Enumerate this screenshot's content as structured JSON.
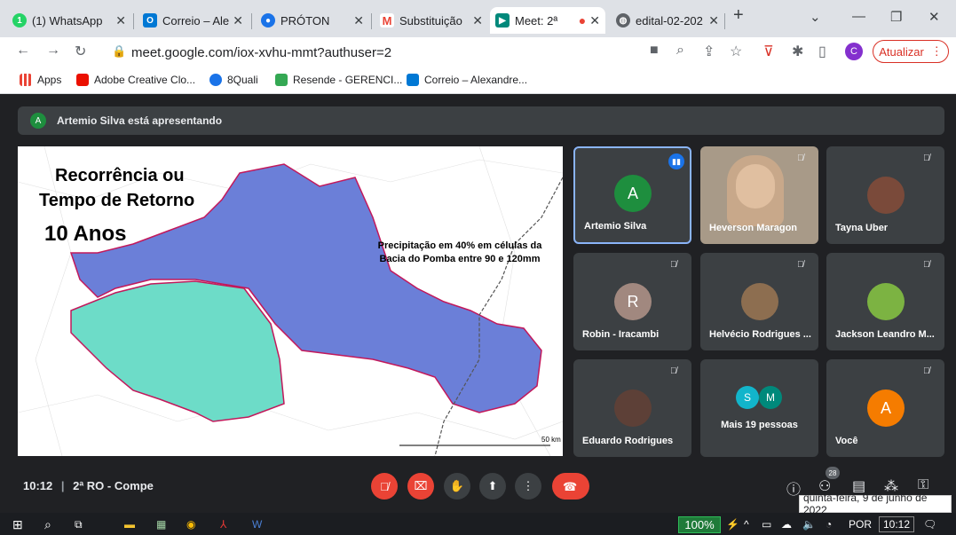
{
  "tabs": [
    {
      "label": "(1) WhatsApp",
      "icon": "whatsapp-icon",
      "color": "#25d366",
      "badge": "1"
    },
    {
      "label": "Correio – Alex",
      "icon": "outlook-icon",
      "color": "#0078d4"
    },
    {
      "label": "PRÓTON",
      "icon": "proton-icon",
      "color": "#1a73e8"
    },
    {
      "label": "Substituição",
      "icon": "gmail-icon",
      "color": "#ea4335"
    },
    {
      "label": "Meet: 2ª",
      "icon": "meet-icon",
      "color": "#00897b"
    },
    {
      "label": "edital-02-202",
      "icon": "globe-icon",
      "color": "#5f6368"
    }
  ],
  "address": {
    "url": "meet.google.com/iox-xvhu-mmt?authuser=2"
  },
  "browser": {
    "update_label": "Atualizar",
    "profile": "C"
  },
  "bookmarks": [
    {
      "label": "Apps",
      "color": "#ea4335"
    },
    {
      "label": "Adobe Creative Clo...",
      "color": "#eb1000"
    },
    {
      "label": "8Quali",
      "color": "#1a73e8"
    },
    {
      "label": "Resende - GERENCI...",
      "color": "#34a853"
    },
    {
      "label": "Correio – Alexandre...",
      "color": "#0078d4"
    }
  ],
  "banner": {
    "avatar": "A",
    "text": "Artemio Silva está apresentando"
  },
  "slide": {
    "title_line1": "Recorrência ou",
    "title_line2": "Tempo de Retorno",
    "title_line3": "10 Anos",
    "caption_line1": "Precipitação em 40%  em células da",
    "caption_line2": "Bacia do Pomba entre 90 e 120mm",
    "scale_label": "50 km",
    "colors": {
      "blue_region": "#6b7fd8",
      "teal_region": "#6ddcc8",
      "border": "#c2185b"
    }
  },
  "participants": [
    {
      "name": "Artemio Silva",
      "avatar": "A",
      "avatar_color": "#1e8e3e",
      "speaking": true
    },
    {
      "name": "Heverson Maragon",
      "avatar": "video"
    },
    {
      "name": "Tayna Uber",
      "avatar": "photo"
    },
    {
      "name": "Robin - Iracambi",
      "avatar": "R",
      "avatar_color": "#a1887f"
    },
    {
      "name": "Helvécio Rodrigues ...",
      "avatar": "photo"
    },
    {
      "name": "Jackson Leandro M...",
      "avatar": "photo"
    },
    {
      "name": "Eduardo Rodrigues",
      "avatar": "photo"
    },
    {
      "name": "Mais 19 pessoas",
      "avatar": "S M"
    },
    {
      "name": "Você",
      "avatar": "A",
      "avatar_color": "#f57c00"
    }
  ],
  "meeting": {
    "time": "10:12",
    "title": "2ª RO - Compe",
    "participant_count": "28"
  },
  "tooltip": "quinta-feira, 9 de junho de 2022",
  "taskbar": {
    "battery": "100%",
    "lang": "POR",
    "clock": "10:12"
  }
}
